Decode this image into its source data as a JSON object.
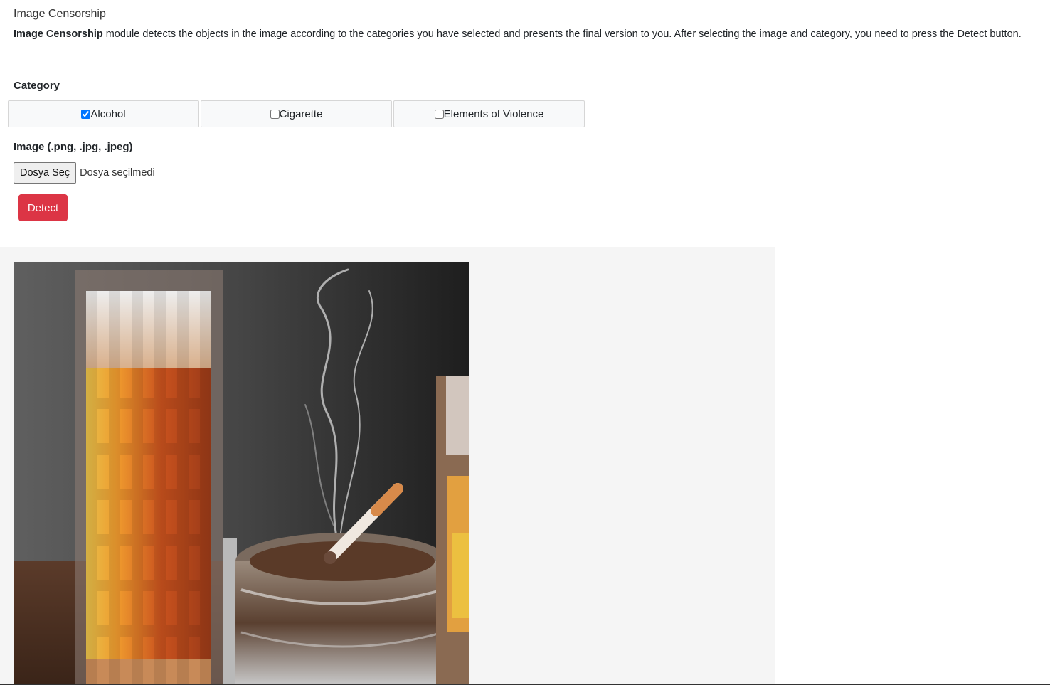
{
  "header": {
    "title": "Image Censorship",
    "description_bold": "Image Censorship",
    "description_rest": " module detects the objects in the image according to the categories you have selected and presents the final version to you. After selecting the image and category, you need to press the Detect button."
  },
  "category": {
    "label": "Category",
    "options": [
      {
        "label": "Alcohol",
        "checked": true
      },
      {
        "label": "Cigarette",
        "checked": false
      },
      {
        "label": "Elements of Violence",
        "checked": false
      }
    ]
  },
  "image_input": {
    "label": "Image (.png, .jpg, .jpeg)",
    "button_label": "Dosya Seç",
    "status": "Dosya seçilmedi"
  },
  "detect_button": {
    "label": "Detect",
    "color": "#dc3545"
  },
  "result": {
    "image_description_icon": "censored-result-image"
  }
}
